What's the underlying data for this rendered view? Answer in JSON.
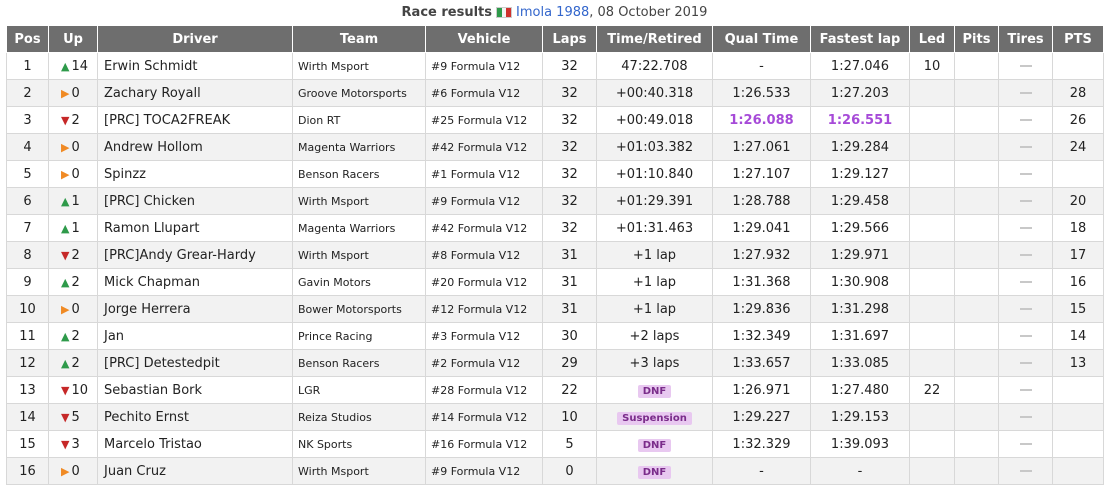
{
  "caption": {
    "title": "Race results",
    "flag": "italy-flag-icon",
    "track": "Imola 1988",
    "date": ", 08 October 2019"
  },
  "headers": [
    "Pos",
    "Up",
    "Driver",
    "Team",
    "Vehicle",
    "Laps",
    "Time/Retired",
    "Qual Time",
    "Fastest lap",
    "Led",
    "Pits",
    "Tires",
    "PTS"
  ],
  "colors": {
    "header_bg": "#6e6e6e",
    "up": "#2e9a4a",
    "down": "#c62828",
    "same": "#f08a24",
    "best": "#a64ad8",
    "badge_bg": "#e8c8f0"
  },
  "rows": [
    {
      "pos": "1",
      "dir": "up",
      "up": "14",
      "driver": "Erwin Schmidt",
      "team": "Wirth Msport",
      "vehicle": "#9 Formula V12",
      "laps": "32",
      "time": "47:22.708",
      "qual": "-",
      "fastest": "1:27.046",
      "led": "10",
      "pts": ""
    },
    {
      "pos": "2",
      "dir": "same",
      "up": "0",
      "driver": "Zachary Royall",
      "team": "Groove Motorsports",
      "vehicle": "#6 Formula V12",
      "laps": "32",
      "time": "+00:40.318",
      "qual": "1:26.533",
      "fastest": "1:27.203",
      "led": "",
      "pts": "28"
    },
    {
      "pos": "3",
      "dir": "down",
      "up": "2",
      "driver": "[PRC] TOCA2FREAK",
      "team": "Dion RT",
      "vehicle": "#25 Formula V12",
      "laps": "32",
      "time": "+00:49.018",
      "qual": "1:26.088",
      "qual_best": true,
      "fastest": "1:26.551",
      "fastest_best": true,
      "led": "",
      "pts": "26"
    },
    {
      "pos": "4",
      "dir": "same",
      "up": "0",
      "driver": "Andrew Hollom",
      "team": "Magenta Warriors",
      "vehicle": "#42 Formula V12",
      "laps": "32",
      "time": "+01:03.382",
      "qual": "1:27.061",
      "fastest": "1:29.284",
      "led": "",
      "pts": "24"
    },
    {
      "pos": "5",
      "dir": "same",
      "up": "0",
      "driver": "Spinzz",
      "team": "Benson Racers",
      "vehicle": "#1 Formula V12",
      "laps": "32",
      "time": "+01:10.840",
      "qual": "1:27.107",
      "fastest": "1:29.127",
      "led": "",
      "pts": ""
    },
    {
      "pos": "6",
      "dir": "up",
      "up": "1",
      "driver": "[PRC] Chicken",
      "team": "Wirth Msport",
      "vehicle": "#9 Formula V12",
      "laps": "32",
      "time": "+01:29.391",
      "qual": "1:28.788",
      "fastest": "1:29.458",
      "led": "",
      "pts": "20"
    },
    {
      "pos": "7",
      "dir": "up",
      "up": "1",
      "driver": "Ramon Llupart",
      "team": "Magenta Warriors",
      "vehicle": "#42 Formula V12",
      "laps": "32",
      "time": "+01:31.463",
      "qual": "1:29.041",
      "fastest": "1:29.566",
      "led": "",
      "pts": "18"
    },
    {
      "pos": "8",
      "dir": "down",
      "up": "2",
      "driver": "[PRC]Andy Grear-Hardy",
      "team": "Wirth Msport",
      "vehicle": "#8 Formula V12",
      "laps": "31",
      "time": "+1 lap",
      "qual": "1:27.932",
      "fastest": "1:29.971",
      "led": "",
      "pts": "17"
    },
    {
      "pos": "9",
      "dir": "up",
      "up": "2",
      "driver": "Mick Chapman",
      "team": "Gavin Motors",
      "vehicle": "#20 Formula V12",
      "laps": "31",
      "time": "+1 lap",
      "qual": "1:31.368",
      "fastest": "1:30.908",
      "led": "",
      "pts": "16"
    },
    {
      "pos": "10",
      "dir": "same",
      "up": "0",
      "driver": "Jorge Herrera",
      "team": "Bower Motorsports",
      "vehicle": "#12 Formula V12",
      "laps": "31",
      "time": "+1 lap",
      "qual": "1:29.836",
      "fastest": "1:31.298",
      "led": "",
      "pts": "15"
    },
    {
      "pos": "11",
      "dir": "up",
      "up": "2",
      "driver": "Jan",
      "team": "Prince Racing",
      "vehicle": "#3 Formula V12",
      "laps": "30",
      "time": "+2 laps",
      "qual": "1:32.349",
      "fastest": "1:31.697",
      "led": "",
      "pts": "14"
    },
    {
      "pos": "12",
      "dir": "up",
      "up": "2",
      "driver": "[PRC] Detestedpit",
      "team": "Benson Racers",
      "vehicle": "#2 Formula V12",
      "laps": "29",
      "time": "+3 laps",
      "qual": "1:33.657",
      "fastest": "1:33.085",
      "led": "",
      "pts": "13"
    },
    {
      "pos": "13",
      "dir": "down",
      "up": "10",
      "driver": "Sebastian Bork",
      "team": "LGR",
      "vehicle": "#28 Formula V12",
      "laps": "22",
      "time": "DNF",
      "time_badge": true,
      "qual": "1:26.971",
      "fastest": "1:27.480",
      "led": "22",
      "pts": ""
    },
    {
      "pos": "14",
      "dir": "down",
      "up": "5",
      "driver": "Pechito Ernst",
      "team": "Reiza Studios",
      "vehicle": "#14 Formula V12",
      "laps": "10",
      "time": "Suspension",
      "time_badge": true,
      "qual": "1:29.227",
      "fastest": "1:29.153",
      "led": "",
      "pts": ""
    },
    {
      "pos": "15",
      "dir": "down",
      "up": "3",
      "driver": "Marcelo Tristao",
      "team": "NK Sports",
      "vehicle": "#16 Formula V12",
      "laps": "5",
      "time": "DNF",
      "time_badge": true,
      "qual": "1:32.329",
      "fastest": "1:39.093",
      "led": "",
      "pts": ""
    },
    {
      "pos": "16",
      "dir": "same",
      "up": "0",
      "driver": "Juan Cruz",
      "team": "Wirth Msport",
      "vehicle": "#9 Formula V12",
      "laps": "0",
      "time": "DNF",
      "time_badge": true,
      "qual": "-",
      "fastest": "-",
      "led": "",
      "pts": ""
    }
  ]
}
